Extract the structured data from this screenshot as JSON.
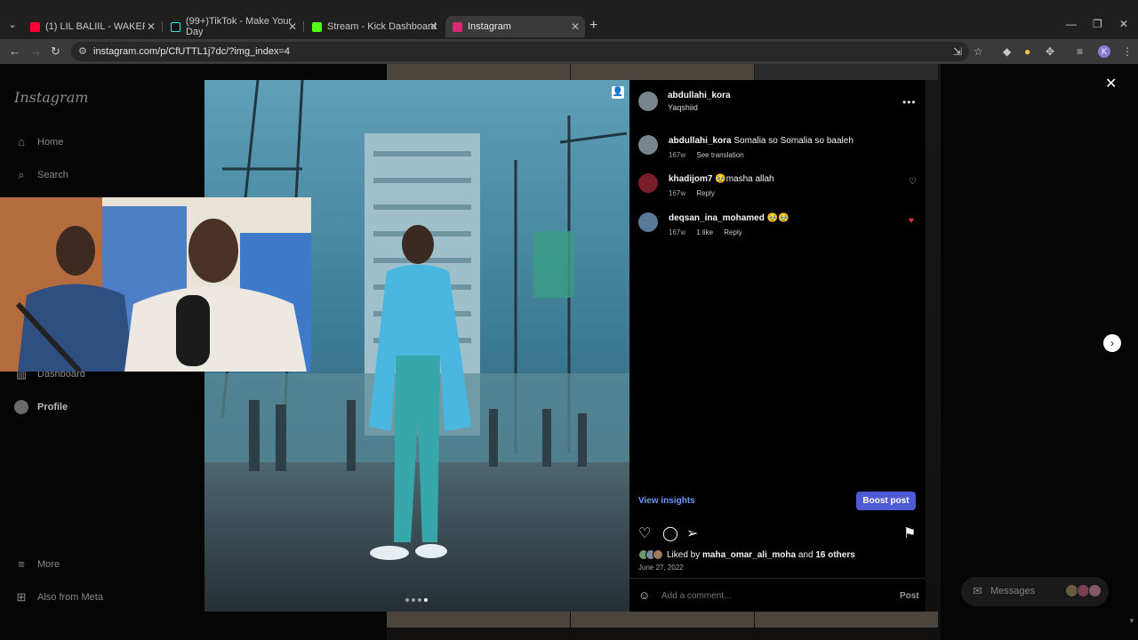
{
  "browser": {
    "tabs": [
      {
        "title": "(1) LIL BALIIL - WAKERE ( OFFICIA",
        "color": "#ff0033",
        "active": false
      },
      {
        "title": "(99+)TikTok - Make Your Day",
        "color": "#111111",
        "active": false
      },
      {
        "title": "Stream - Kick Dashboard",
        "color": "#53fc18",
        "active": false
      },
      {
        "title": "Instagram",
        "color": "#d62976",
        "active": true
      }
    ],
    "url": "instagram.com/p/CfUTTL1j7dc/?img_index=4",
    "profile_letter": "K"
  },
  "sidebar": {
    "logo": "Instagram",
    "items": [
      {
        "label": "Home",
        "icon": "home-icon"
      },
      {
        "label": "Search",
        "icon": "search-icon"
      },
      {
        "label": "Dashboard",
        "icon": "dashboard-icon"
      },
      {
        "label": "Profile",
        "icon": "profile-avatar"
      },
      {
        "label": "More",
        "icon": "menu-icon"
      },
      {
        "label": "Also from Meta",
        "icon": "meta-icon"
      }
    ]
  },
  "post": {
    "author": "abdullahi_kora",
    "location": "Yaqshiid",
    "comments": [
      {
        "user": "abdullahi_kora",
        "text": "Somalia so Somalia so baaleh",
        "time": "167w",
        "action": "See translation",
        "likes": "",
        "liked": false,
        "is_caption": true
      },
      {
        "user": "khadijom7",
        "text": "🥹masha allah",
        "time": "167w",
        "action": "Reply",
        "likes": "",
        "liked": false,
        "is_caption": false
      },
      {
        "user": "deqsan_ina_mohamed",
        "text": "🥹🥹",
        "time": "167w",
        "action": "Reply",
        "likes": "1 like",
        "liked": true,
        "is_caption": false
      }
    ],
    "view_insights": "View insights",
    "boost_label": "Boost post",
    "liked_by_prefix": "Liked by",
    "liked_by_user": "maha_omar_ali_moha",
    "liked_by_and": "and",
    "liked_by_others": "16 others",
    "date": "June 27, 2022",
    "comment_placeholder": "Add a comment...",
    "post_label": "Post",
    "image_index": 4,
    "image_count": 4
  },
  "messages": {
    "label": "Messages"
  },
  "colors": {
    "accent_blue": "#4f5bd5",
    "link_blue": "#6e9bf5",
    "heart_red": "#ff3040"
  }
}
